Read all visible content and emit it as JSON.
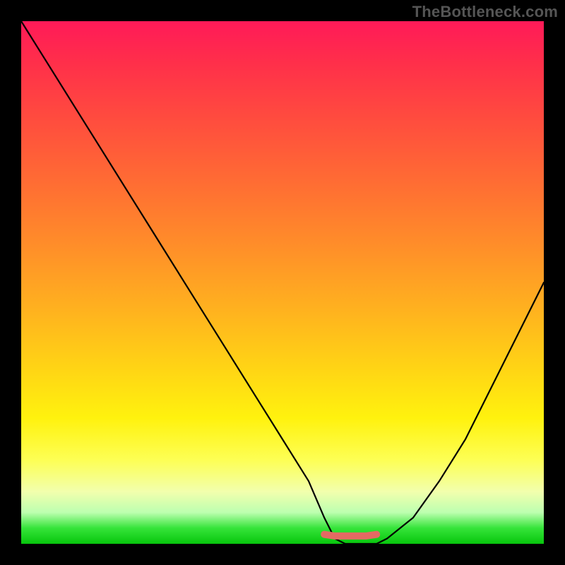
{
  "watermark": "TheBottleneck.com",
  "chart_data": {
    "type": "line",
    "title": "",
    "xlabel": "",
    "ylabel": "",
    "xlim": [
      0,
      100
    ],
    "ylim": [
      0,
      100
    ],
    "grid": false,
    "legend": false,
    "series": [
      {
        "name": "main-curve",
        "color": "#000000",
        "x": [
          0,
          5,
          10,
          15,
          20,
          25,
          30,
          35,
          40,
          45,
          50,
          55,
          58,
          60,
          62,
          65,
          68,
          70,
          75,
          80,
          85,
          90,
          95,
          100
        ],
        "values": [
          100,
          92,
          84,
          76,
          68,
          60,
          52,
          44,
          36,
          28,
          20,
          12,
          5,
          1,
          0,
          0,
          0,
          1,
          5,
          12,
          20,
          30,
          40,
          50
        ]
      },
      {
        "name": "flat-bottom-marker",
        "color": "#e46a63",
        "x": [
          58,
          60,
          62,
          64,
          66,
          68
        ],
        "values": [
          1.8,
          1.5,
          1.5,
          1.5,
          1.5,
          1.8
        ]
      }
    ],
    "gradient_stops": [
      {
        "pct": 0,
        "color": "#ff1a58"
      },
      {
        "pct": 8,
        "color": "#ff2f4a"
      },
      {
        "pct": 18,
        "color": "#ff4a3f"
      },
      {
        "pct": 30,
        "color": "#ff6a34"
      },
      {
        "pct": 42,
        "color": "#ff8b2a"
      },
      {
        "pct": 55,
        "color": "#ffb11f"
      },
      {
        "pct": 66,
        "color": "#ffd315"
      },
      {
        "pct": 76,
        "color": "#fff20e"
      },
      {
        "pct": 84,
        "color": "#fdff55"
      },
      {
        "pct": 90,
        "color": "#f2ffad"
      },
      {
        "pct": 94,
        "color": "#bdffb0"
      },
      {
        "pct": 97,
        "color": "#35e43a"
      },
      {
        "pct": 100,
        "color": "#08c60d"
      }
    ]
  }
}
